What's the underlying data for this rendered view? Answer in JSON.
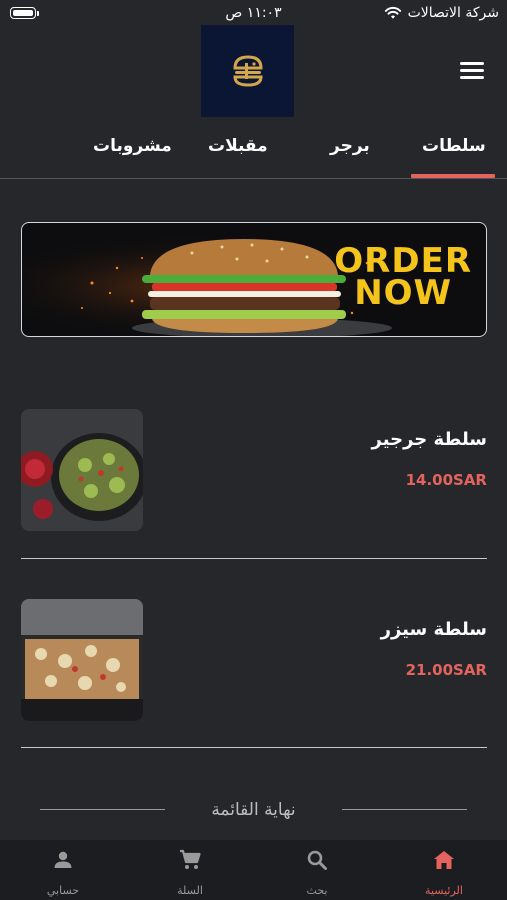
{
  "status_bar": {
    "carrier": "شركة الاتصالات",
    "time": "١١:٠٣ ص"
  },
  "header": {
    "menu_icon": "hamburger-menu-icon",
    "logo_icon": "burger-logo-icon"
  },
  "tabs": [
    {
      "label": "سلطات",
      "active": true
    },
    {
      "label": "برجر",
      "active": false
    },
    {
      "label": "مقبلات",
      "active": false
    },
    {
      "label": "مشروبات",
      "active": false
    }
  ],
  "banner": {
    "line1": "ORDER",
    "line2": "NOW"
  },
  "items": [
    {
      "name": "سلطة جرجير",
      "price": "14.00SAR"
    },
    {
      "name": "سلطة سيزر",
      "price": "21.00SAR"
    }
  ],
  "end_of_list": "نهاية القائمة",
  "bottom_nav": [
    {
      "label": "الرئيسية",
      "icon": "home-icon",
      "active": true
    },
    {
      "label": "بحث",
      "icon": "search-icon",
      "active": false
    },
    {
      "label": "السلة",
      "icon": "cart-icon",
      "active": false
    },
    {
      "label": "حسابي",
      "icon": "person-icon",
      "active": false
    }
  ],
  "colors": {
    "accent": "#e3645f",
    "background": "#26272b",
    "banner_text": "#f4c41a"
  }
}
